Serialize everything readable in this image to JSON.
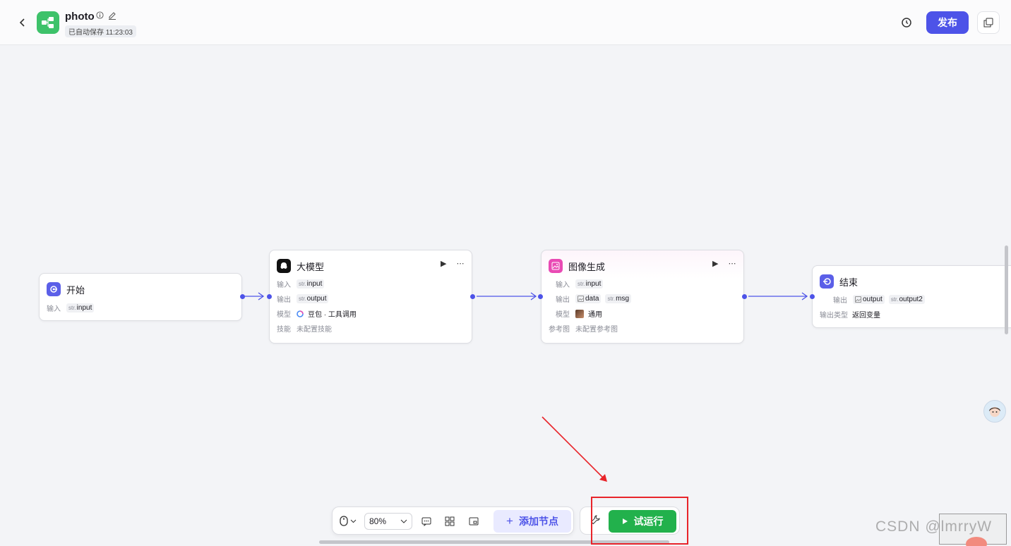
{
  "header": {
    "title": "photo",
    "saved_status": "已自动保存 11:23:03",
    "publish_label": "发布"
  },
  "nodes": {
    "start": {
      "title": "开始",
      "input_label": "输入",
      "input_type": "str.",
      "input_value": "input"
    },
    "llm": {
      "title": "大模型",
      "input_label": "输入",
      "input_type": "str.",
      "input_value": "input",
      "output_label": "输出",
      "output_type": "str.",
      "output_value": "output",
      "model_label": "模型",
      "model_value": "豆包 · 工具调用",
      "skill_label": "技能",
      "skill_value": "未配置技能"
    },
    "image_gen": {
      "title": "图像生成",
      "input_label": "输入",
      "input_type": "str.",
      "input_value": "input",
      "output_label": "输出",
      "output_value_1": "data",
      "output_type_2": "str.",
      "output_value_2": "msg",
      "model_label": "模型",
      "model_value": "通用",
      "ref_label": "参考图",
      "ref_value": "未配置参考图"
    },
    "end": {
      "title": "结束",
      "output_label": "输出",
      "output_value_1": "output",
      "output_type_2": "str.",
      "output_value_2": "output2",
      "output_kind_label": "输出类型",
      "output_kind_value": "返回变量"
    }
  },
  "toolbar": {
    "zoom": "80%",
    "add_node_label": "添加节点",
    "run_label": "试运行"
  },
  "watermark": "CSDN @lmrryW",
  "colors": {
    "accent": "#4d53e8",
    "run_green": "#22b14c",
    "highlight_red": "#e8242a",
    "start_icon": "#5b5fe8",
    "image_icon": "#e94ab4",
    "app_icon": "#3ec26a"
  }
}
